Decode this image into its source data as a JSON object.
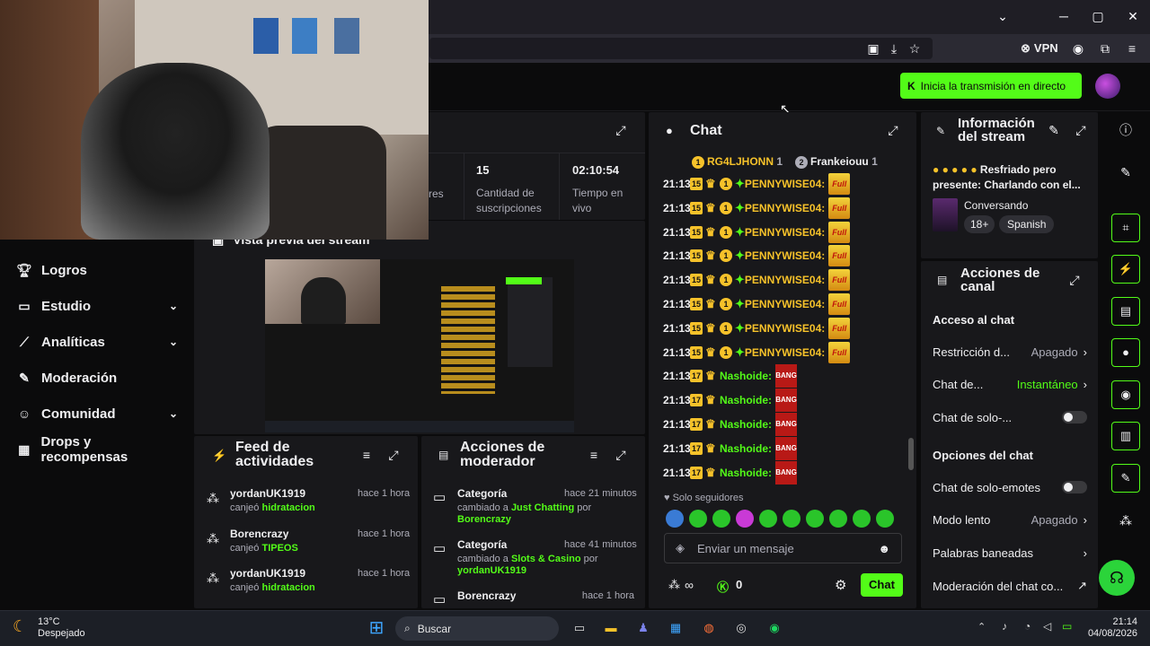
{
  "browser": {
    "vpn_label": "VPN",
    "minimize": "─",
    "maximize": "▢",
    "close": "✕",
    "dropdown": "⌄"
  },
  "header": {
    "go_live_label": "Inicia la transmisión en directo",
    "accent": "#53fc18"
  },
  "sidebar": {
    "items": [
      {
        "label": "Logros",
        "icon": "trophy-icon",
        "chev": ""
      },
      {
        "label": "Estudio",
        "icon": "studio-icon",
        "chev": "⌄"
      },
      {
        "label": "Analíticas",
        "icon": "analytics-icon",
        "chev": "⌄"
      },
      {
        "label": "Moderación",
        "icon": "wrench-icon",
        "chev": ""
      },
      {
        "label": "Comunidad",
        "icon": "community-icon",
        "chev": "⌄"
      },
      {
        "label": "Drops y recompensas",
        "icon": "gift-icon",
        "chev": ""
      }
    ]
  },
  "stats": {
    "partial_label": "res",
    "subs_value": "15",
    "subs_label1": "Cantidad de",
    "subs_label2": "suscripciones",
    "time_value": "02:10:54",
    "time_label1": "Tiempo en",
    "time_label2": "vivo"
  },
  "preview": {
    "title": "Vista previa del stream"
  },
  "chat": {
    "title": "Chat",
    "top_users": [
      {
        "rank": "1",
        "name": "RG4LJHONN",
        "count": "1"
      },
      {
        "rank": "2",
        "name": "Frankeiouu",
        "count": "1"
      }
    ],
    "messages": [
      {
        "time": "21:13",
        "sub": "15",
        "user": "PENNYWISE04:",
        "emote": "Full",
        "kind": "penny"
      },
      {
        "time": "21:13",
        "sub": "15",
        "user": "PENNYWISE04:",
        "emote": "Full",
        "kind": "penny"
      },
      {
        "time": "21:13",
        "sub": "15",
        "user": "PENNYWISE04:",
        "emote": "Full",
        "kind": "penny"
      },
      {
        "time": "21:13",
        "sub": "15",
        "user": "PENNYWISE04:",
        "emote": "Full",
        "kind": "penny"
      },
      {
        "time": "21:13",
        "sub": "15",
        "user": "PENNYWISE04:",
        "emote": "Full",
        "kind": "penny"
      },
      {
        "time": "21:13",
        "sub": "15",
        "user": "PENNYWISE04:",
        "emote": "Full",
        "kind": "penny"
      },
      {
        "time": "21:13",
        "sub": "15",
        "user": "PENNYWISE04:",
        "emote": "Full",
        "kind": "penny"
      },
      {
        "time": "21:13",
        "sub": "15",
        "user": "PENNYWISE04:",
        "emote": "Full",
        "kind": "penny"
      },
      {
        "time": "21:13",
        "sub": "17",
        "user": "Nashoide:",
        "emote": "BANG",
        "kind": "nasho"
      },
      {
        "time": "21:13",
        "sub": "17",
        "user": "Nashoide:",
        "emote": "BANG",
        "kind": "nasho"
      },
      {
        "time": "21:13",
        "sub": "17",
        "user": "Nashoide:",
        "emote": "BANG",
        "kind": "nasho"
      },
      {
        "time": "21:13",
        "sub": "17",
        "user": "Nashoide:",
        "emote": "BANG",
        "kind": "nasho"
      },
      {
        "time": "21:13",
        "sub": "17",
        "user": "Nashoide:",
        "emote": "BANG",
        "kind": "nasho"
      }
    ],
    "followers_only": "Solo seguidores",
    "input_placeholder": "Enviar un mensaje",
    "kick_count": "0",
    "send_label": "Chat"
  },
  "stream_info": {
    "title1": "Información",
    "title2": "del stream",
    "stream_title": "Resfriado pero presente: Charlando con el...",
    "category": "Conversando",
    "tag_age": "18+",
    "tag_lang": "Spanish"
  },
  "channel_actions": {
    "title1": "Acciones de",
    "title2": "canal",
    "section_access": "Acceso al chat",
    "rows_access": [
      {
        "label": "Restricción d...",
        "value": "Apagado",
        "type": "arrow"
      },
      {
        "label": "Chat de...",
        "value": "Instantáneo",
        "type": "arrow-green"
      },
      {
        "label": "Chat de solo-...",
        "value": "",
        "type": "toggle"
      }
    ],
    "section_options": "Opciones del chat",
    "rows_options": [
      {
        "label": "Chat de solo-emotes",
        "value": "",
        "type": "toggle"
      },
      {
        "label": "Modo lento",
        "value": "Apagado",
        "type": "arrow"
      },
      {
        "label": "Palabras baneadas",
        "value": "",
        "type": "arrow"
      },
      {
        "label": "Moderación del chat co...",
        "value": "",
        "type": "external"
      }
    ]
  },
  "activity_feed": {
    "title1": "Feed de",
    "title2": "actividades",
    "items": [
      {
        "user": "yordanUK1919",
        "time": "hace 1 hora",
        "action": "canjeó",
        "reward": "hidratacion"
      },
      {
        "user": "Borencrazy",
        "time": "hace 1 hora",
        "action": "canjeó",
        "reward": "TIPEOS"
      },
      {
        "user": "yordanUK1919",
        "time": "hace 1 hora",
        "action": "canjeó",
        "reward": "hidratacion"
      }
    ]
  },
  "mod_actions": {
    "title1": "Acciones de",
    "title2": "moderador",
    "items": [
      {
        "title": "Categoría",
        "time": "hace 21 minutos",
        "pre": "cambiado a",
        "target": "Just Chatting",
        "by": "por",
        "user": "Borencrazy"
      },
      {
        "title": "Categoría",
        "time": "hace 41 minutos",
        "pre": "cambiado a",
        "target": "Slots & Casino",
        "by": "por",
        "user": "yordanUK1919"
      },
      {
        "title": "Borencrazy",
        "time": "hace 1 hora",
        "pre": "",
        "target": "",
        "by": "",
        "user": ""
      }
    ]
  },
  "taskbar": {
    "weather_temp": "13°C",
    "weather_desc": "Despejado",
    "search_label": "Buscar",
    "time": "21:14",
    "date": "04/08/2026"
  }
}
